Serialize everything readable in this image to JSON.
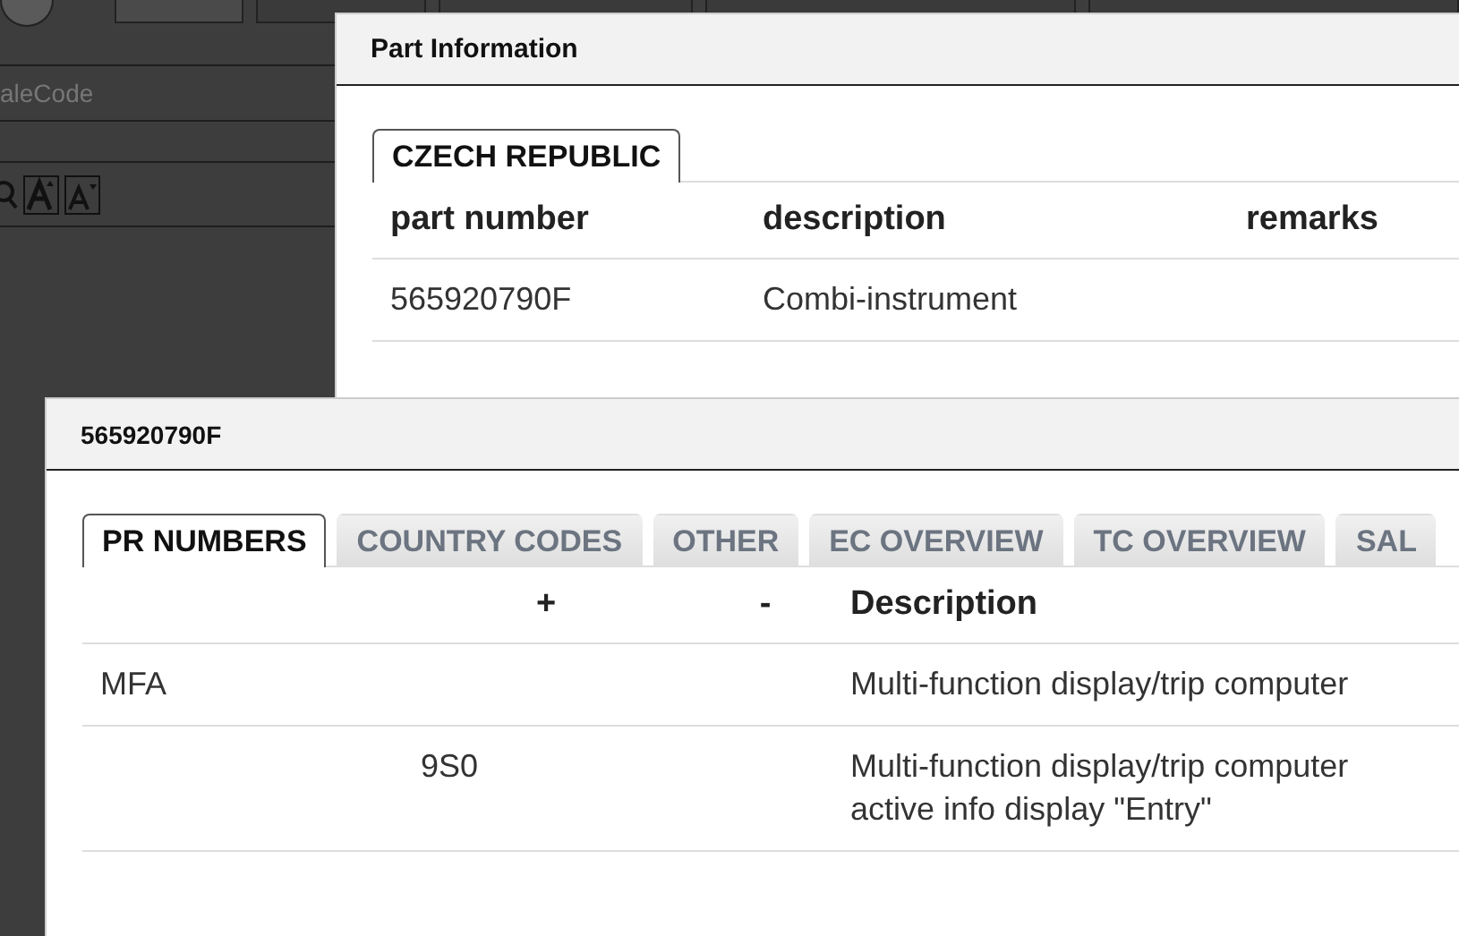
{
  "background": {
    "tabs": [
      {
        "selected": true
      },
      {
        "selected": false
      },
      {
        "selected": false
      },
      {
        "selected": false
      },
      {
        "selected": false
      }
    ],
    "search_field": {
      "placeholder": "aleCode"
    }
  },
  "part_information": {
    "title": "Part Information",
    "tabs": [
      {
        "label": "CZECH REPUBLIC",
        "selected": true
      }
    ],
    "columns": [
      "part number",
      "description",
      "remarks"
    ],
    "rows": [
      [
        "565920790F",
        "Combi-instrument",
        ""
      ]
    ]
  },
  "part_detail": {
    "title": "565920790F",
    "tabs": [
      {
        "label": "PR NUMBERS",
        "selected": true
      },
      {
        "label": "COUNTRY CODES",
        "selected": false
      },
      {
        "label": "OTHER",
        "selected": false
      },
      {
        "label": "EC OVERVIEW",
        "selected": false
      },
      {
        "label": "TC OVERVIEW",
        "selected": false
      },
      {
        "label": "SAL",
        "selected": false
      }
    ],
    "columns": [
      "",
      "+",
      "-",
      "Description"
    ],
    "rows": [
      [
        "MFA",
        "",
        "",
        "Multi-function display/trip computer"
      ],
      [
        "",
        "9S0",
        "",
        "Multi-function display/trip computer\nactive info display \"Entry\""
      ]
    ]
  }
}
